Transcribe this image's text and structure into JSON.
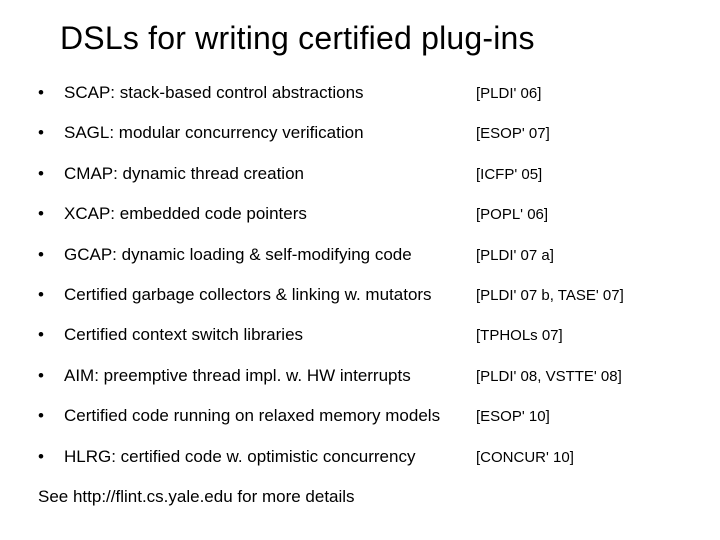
{
  "title": "DSLs for writing certified plug-ins",
  "items": [
    {
      "desc": "SCAP: stack-based control abstractions",
      "cite": "[PLDI' 06]"
    },
    {
      "desc": "SAGL: modular concurrency verification",
      "cite": "[ESOP' 07]"
    },
    {
      "desc": "CMAP: dynamic thread creation",
      "cite": "[ICFP' 05]"
    },
    {
      "desc": "XCAP: embedded code pointers",
      "cite": "[POPL' 06]"
    },
    {
      "desc": "GCAP: dynamic loading & self-modifying code",
      "cite": "[PLDI' 07 a]"
    },
    {
      "desc": "Certified garbage collectors & linking w. mutators",
      "cite": "[PLDI' 07 b, TASE' 07]"
    },
    {
      "desc": "Certified context switch libraries",
      "cite": "[TPHOLs 07]"
    },
    {
      "desc": "AIM:  preemptive thread impl. w. HW interrupts",
      "cite": "[PLDI' 08, VSTTE' 08]"
    },
    {
      "desc": "Certified code running on relaxed memory models",
      "cite": "[ESOP' 10]"
    },
    {
      "desc": "HLRG: certified code w. optimistic concurrency",
      "cite": "[CONCUR' 10]"
    }
  ],
  "footer": "See http://flint.cs.yale.edu for more details",
  "bullet_char": "•"
}
